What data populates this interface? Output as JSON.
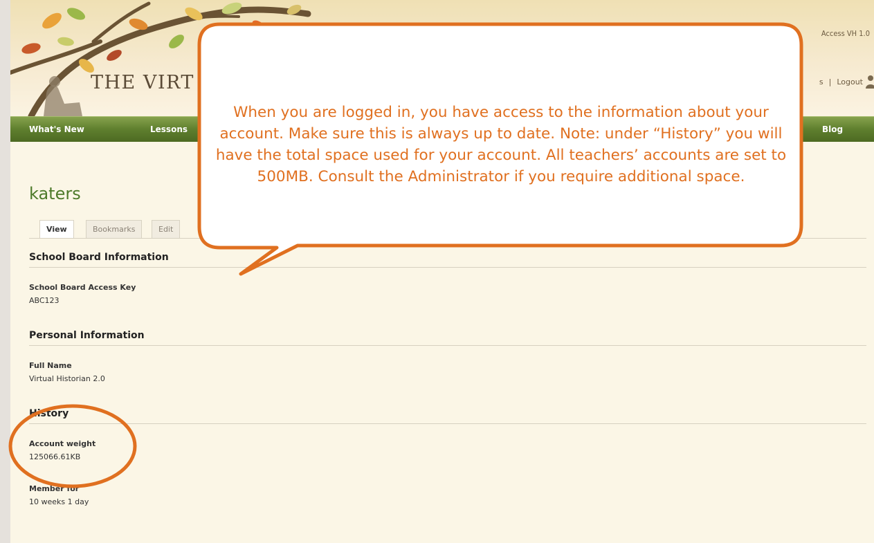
{
  "header": {
    "site_title": "THE VIRT",
    "top_link": "Access VH 1.0",
    "user_links": {
      "partial": "s",
      "separator": "|",
      "logout": "Logout"
    }
  },
  "nav": [
    "What's New",
    "Lessons",
    "Blog"
  ],
  "profile": {
    "username": "katers",
    "tabs": [
      "View",
      "Bookmarks",
      "Edit"
    ],
    "active_tab": "View",
    "sections": [
      {
        "title": "School Board Information",
        "fields": [
          {
            "label": "School Board Access Key",
            "value": "ABC123"
          }
        ]
      },
      {
        "title": "Personal Information",
        "fields": [
          {
            "label": "Full Name",
            "value": "Virtual Historian 2.0"
          }
        ]
      },
      {
        "title": "History",
        "fields": [
          {
            "label": "Account weight",
            "value": "125066.61KB"
          },
          {
            "label": "Member for",
            "value": "10 weeks 1 day"
          }
        ]
      }
    ]
  },
  "callout": {
    "text": "When you are logged in, you have access to the information about your account. Make sure this is always up to date.  Note: under “History” you will have the  total space used for your account. All teachers’ accounts are set to 500MB. Consult the Administrator if you require additional space.",
    "color": "#e07020"
  },
  "colors": {
    "nav_green": "#5f7f2e",
    "username_green": "#4d7a2a",
    "callout_orange": "#e07020",
    "background": "#fbf6e6"
  }
}
